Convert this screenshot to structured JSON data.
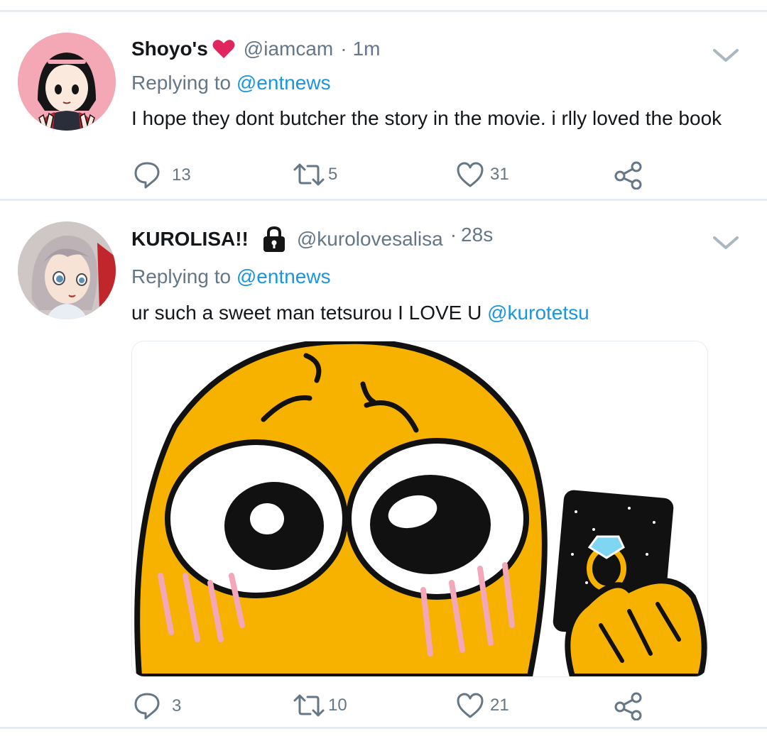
{
  "tweets": [
    {
      "name": "Shoyo's",
      "name_emoji": "heart-icon",
      "handle": "@iamcam",
      "separator": "·",
      "time": "1m",
      "replying_prefix": "Replying to",
      "replying_to": "@entnews",
      "text": "I hope they dont butcher the story in the movie. i rlly loved the book",
      "stats": {
        "replies": "13",
        "retweets": "5",
        "likes": "31"
      }
    },
    {
      "name": "KUROLISA!!",
      "name_emoji": "lock-icon",
      "handle": "@kurolovesalisa",
      "separator": "·",
      "time": "28s",
      "replying_prefix": "Replying to",
      "replying_to": "@entnews",
      "text": "ur such a sweet man tetsurou I LOVE U",
      "text_mention": "@kurotetsu",
      "stats": {
        "replies": "3",
        "retweets": "10",
        "likes": "21"
      }
    }
  ],
  "colors": {
    "accent": "#1b95e0",
    "muted": "#657786",
    "text": "#14171a",
    "divider": "#e6ecf0",
    "heart": "#e0245e",
    "emoji_yellow": "#f7b200"
  }
}
